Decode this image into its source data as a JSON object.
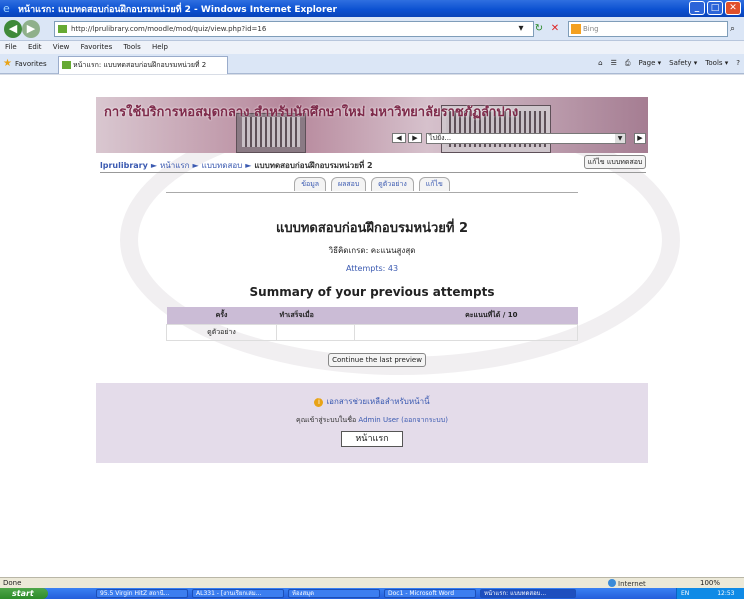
{
  "window": {
    "title": "หน้าแรก: แบบทดสอบก่อนฝึกอบรมหน่วยที่ 2 - Windows Internet Explorer",
    "min": "_",
    "max": "□",
    "close": "✕"
  },
  "address_bar": {
    "url": "http://lprulibrary.com/moodle/mod/quiz/view.php?id=16",
    "search_placeholder": "Bing"
  },
  "menu": [
    "File",
    "Edit",
    "View",
    "Favorites",
    "Tools",
    "Help"
  ],
  "favorites": {
    "label": "Favorites",
    "tab_title": "หน้าแรก: แบบทดสอบก่อนฝึกอบรมหน่วยที่ 2",
    "commands": [
      "Page ▾",
      "Safety ▾",
      "Tools ▾"
    ]
  },
  "page": {
    "banner_title": "การใช้บริการหอสมุดกลาง สำหรับนักศึกษาใหม่ มหาวิทยาลัยราชภัฏลำปาง",
    "jump_label": "ไปยัง...",
    "breadcrumb": [
      "lprulibrary",
      "หน้าแรก",
      "แบบทดสอบ",
      "แบบทดสอบก่อนฝึกอบรมหน่วยที่ 2"
    ],
    "edit_quiz_button": "แก้ไข แบบทดสอบ",
    "tabs": [
      "ข้อมูล",
      "ผลสอบ",
      "ดูตัวอย่าง",
      "แก้ไข"
    ],
    "heading": "แบบทดสอบก่อนฝึกอบรมหน่วยที่ 2",
    "grading_method": "วิธีคิดเกรด: คะแนนสูงสุด",
    "attempts": "Attempts: 43",
    "summary_title": "Summary of your previous attempts",
    "table": {
      "headers": [
        "ครั้ง",
        "ทำเสร็จเมื่อ",
        "คะแนนที่ได้ / 10"
      ],
      "rows": [
        [
          "ดูตัวอย่าง",
          "",
          ""
        ]
      ]
    },
    "continue_button": "Continue the last preview",
    "help_link": "เอกสารช่วยเหลือสำหรับหน้านี้",
    "login_prefix": "คุณเข้าสู่ระบบในชื่อ",
    "login_user": "Admin User",
    "logout_link": "(ออกจากระบบ)",
    "home_button": "หน้าแรก"
  },
  "status": {
    "left": "Done",
    "zone": "Internet",
    "zoom": "100%"
  },
  "taskbar": {
    "start": "start",
    "tasks": [
      "95.5 Virgin HitZ สถานี...",
      "AL331 - [งานเรียกเล่ม...",
      "ห้องสมุด",
      "Doc1 - Microsoft Word",
      "หน้าแรก: แบบทดสอบ..."
    ],
    "tray_lang": "EN",
    "clock": "12:53"
  },
  "colors": {
    "titlebar": "#0a4fd0",
    "link": "#3b5ab1",
    "header_bg": "#cbbcd6",
    "footer_bg": "#e4dcea"
  }
}
